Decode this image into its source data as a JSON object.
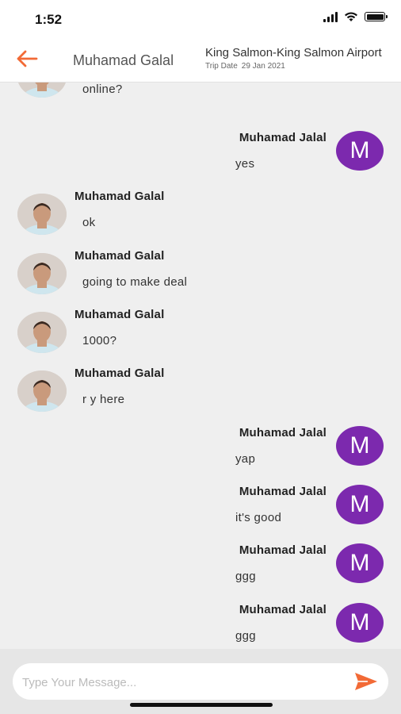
{
  "status_bar": {
    "time": "1:52"
  },
  "header": {
    "contact_name": "Muhamad Galal",
    "trip_route": "King Salmon-King Salmon Airport",
    "trip_date_label": "Trip Date",
    "trip_date": "29 Jan 2021"
  },
  "messages": [
    {
      "side": "in",
      "sender": "",
      "text": "online?"
    },
    {
      "side": "out",
      "sender": "Muhamad Jalal",
      "text": "yes",
      "avatar_letter": "M"
    },
    {
      "side": "in",
      "sender": "Muhamad Galal",
      "text": "ok"
    },
    {
      "side": "in",
      "sender": "Muhamad Galal",
      "text": "going to make deal"
    },
    {
      "side": "in",
      "sender": "Muhamad Galal",
      "text": "1000?"
    },
    {
      "side": "in",
      "sender": "Muhamad Galal",
      "text": "r y here"
    },
    {
      "side": "out",
      "sender": "Muhamad Jalal",
      "text": "yap",
      "avatar_letter": "M"
    },
    {
      "side": "out",
      "sender": "Muhamad Jalal",
      "text": "it's good",
      "avatar_letter": "M"
    },
    {
      "side": "out",
      "sender": "Muhamad Jalal",
      "text": "ggg",
      "avatar_letter": "M"
    },
    {
      "side": "out",
      "sender": "Muhamad Jalal",
      "text": "ggg",
      "avatar_letter": "M"
    }
  ],
  "composer": {
    "placeholder": "Type Your Message..."
  },
  "colors": {
    "accent": "#f26a36",
    "avatar_purple": "#7c29ae",
    "background": "#efefef"
  },
  "icons": {
    "back": "arrow-left-icon",
    "send": "send-icon",
    "wifi": "wifi-icon",
    "battery": "battery-icon",
    "signal": "signal-icon"
  }
}
